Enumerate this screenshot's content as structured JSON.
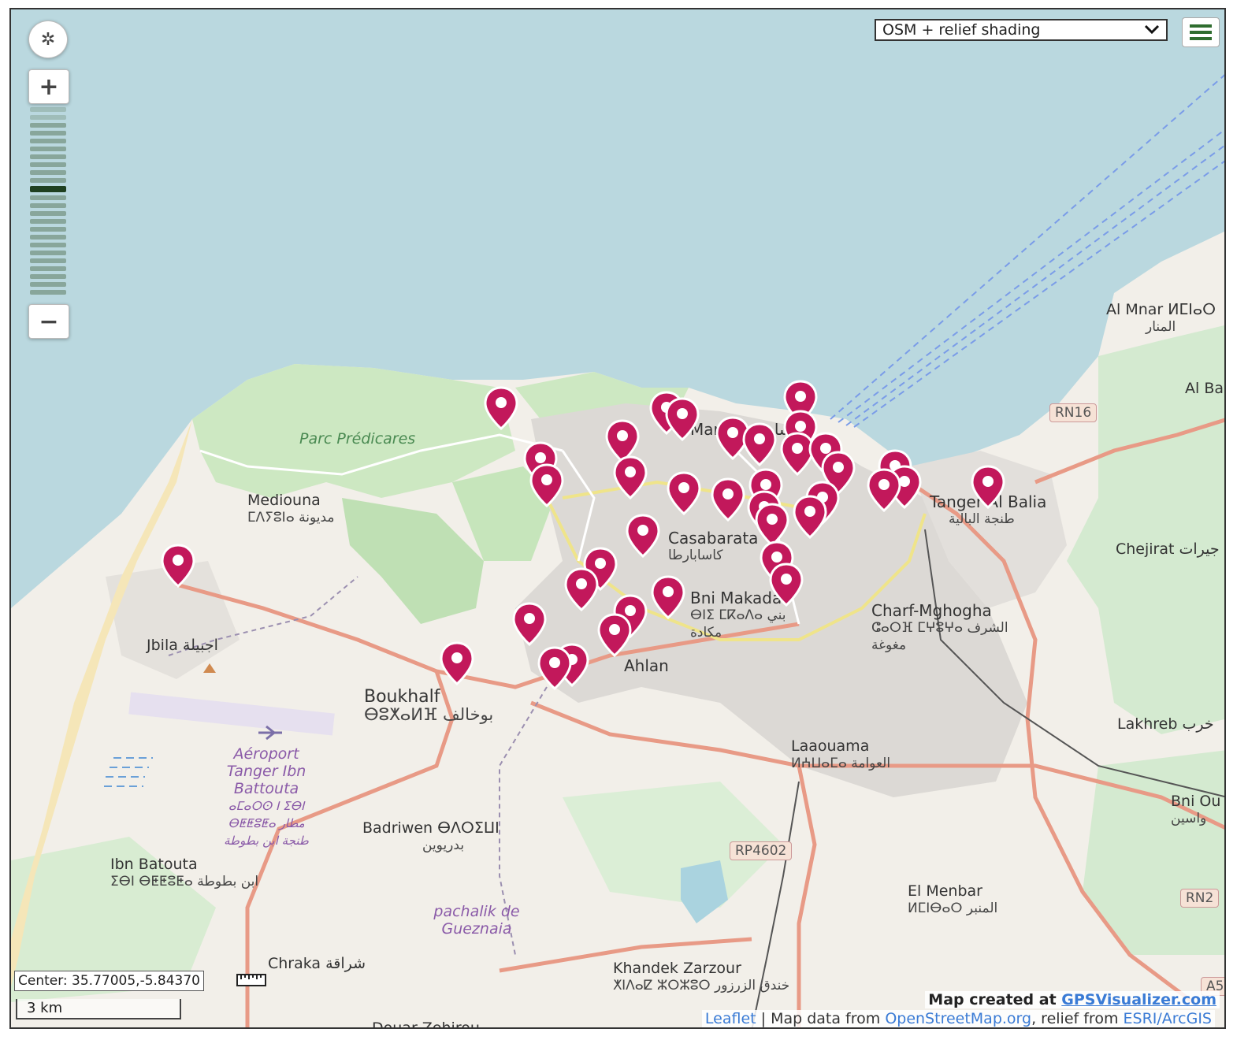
{
  "controls": {
    "recenter_icon": "recenter-icon",
    "zoom_in": "+",
    "zoom_out": "−",
    "layer_select": "OSM + relief shading",
    "center_label": "Center: 35.77005,-5.84370",
    "scale": "3 km"
  },
  "credits": {
    "made_prefix": "Map created at",
    "made_link": "GPSVisualizer.com",
    "leaflet": "Leaflet",
    "data_prefix": " | Map data from ",
    "osm": "OpenStreetMap.org",
    "relief_prefix": ", relief from ",
    "esri": "ESRI/ArcGIS"
  },
  "labels": {
    "parc": "Parc Prédicares",
    "mediouna": "Mediouna",
    "mediouna_sub": "ⵎⴷⵢⵓⵏⴰ مديونة",
    "jbila": "Jbila اجبيلة",
    "boukhalf": "Boukhalf",
    "boukhalf_sub": "ⴱⵓⵅⴰⵍⴼ بوخالف",
    "aeroport": "Aéroport Tanger Ibn Battouta",
    "aeroport_sub": "ⴰⵎⴰⵔⵙ ⵏ ⵉⴱⵏ ⴱⵟⵟⵓⵟⴰ مطار طنجة ابن بطوطة",
    "ibn_batouta": "Ibn Batouta",
    "ibn_batouta_sub": "ⵉⴱⵏ ⴱⵟⵟⵓⵟⴰ ابن بطوطة",
    "badriwen": "Badriwen ⴱⴷⵔⵉⵡⵏ",
    "badriwen_sub": "بدريوين",
    "pachalik": "pachalik de Gueznaia",
    "chraka": "Chraka شراقة",
    "douar": "Douar Zehirou",
    "khandek": "Khandek Zarzour",
    "khandek_sub": "ⵅⵏⴷⴰⵇ ⵣⵔⵣⵓⵔ خندق الزرزور",
    "laaouama": "Laaouama",
    "laaouama_sub": "ⵍⵄⵡⴰⵎⴰ العوامة",
    "el_menbar": "El Menbar",
    "el_menbar_sub": "ⵍⵎⵏⴱⴰⵔ المنبر",
    "charf": "Charf-Mghogha",
    "charf_sub": "ⵛⴰⵔⴼ ⵎⵖⵓⵖⴰ الشرف مغوغة",
    "bni_makada": "Bni Makada",
    "bni_makada_sub": "ⴱⵏⵉ ⵎⴽⴰⴷⴰ بني مكادة",
    "casabarata": "Casabarata",
    "casabarata_sub": "كاسابارطا",
    "ahlan": "Ahlan",
    "marshan": "Marshan مرشان",
    "tanger_balia": "Tanger Al Balia",
    "tanger_balia_sub": "طنجة البالية",
    "al_mnar": "Al Mnar ⵍⵎⵏⴰⵔ",
    "al_mnar_sub": "المنار",
    "al_ba": "Al Ba",
    "chejirat": "Chejirat جيرات",
    "lakhreb": "Lakhreb خرب",
    "bni_ou": "Bni Ou",
    "bni_ou_sub": "واسين",
    "rn16": "RN16",
    "rp4602": "RP4602",
    "rn2": "RN2",
    "a5": "A5"
  },
  "colors": {
    "sea": "#bad8df",
    "land": "#f2efe9",
    "forest": "#c8e6c0",
    "urban": "#d8d6d4",
    "marker": "#c2185b",
    "road": "#e89a86"
  }
}
